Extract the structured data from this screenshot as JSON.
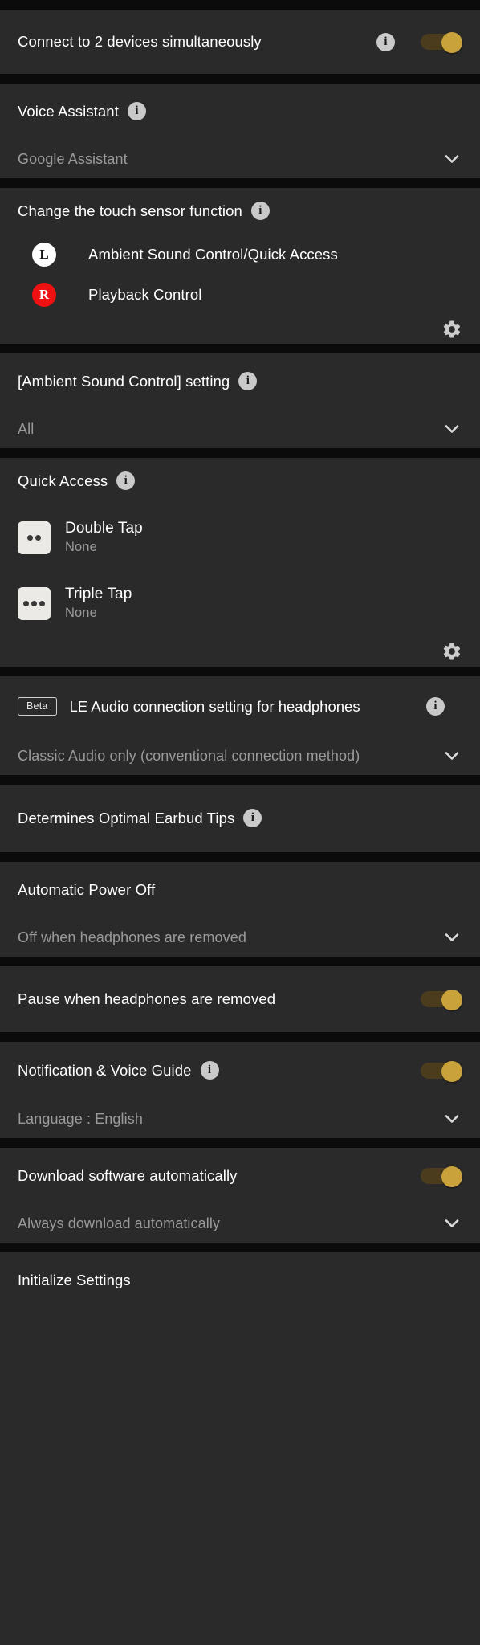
{
  "theme": {
    "page_bg": "#0b0b0b",
    "card_bg": "#2a2a2a",
    "title_color": "#ffffff",
    "secondary_color": "#9a9a9a",
    "toggle_on_knob": "#c9a23c",
    "toggle_on_track": "#4a3c1c",
    "badge_left_bg": "#ffffff",
    "badge_right_bg": "#ee1111"
  },
  "icons": {
    "info": "i",
    "chevron_down": "chevron-down-icon",
    "gear": "gear-icon"
  },
  "sections": {
    "multipoint": {
      "title": "Connect to 2 devices simultaneously",
      "toggle_state": "on"
    },
    "voice_assistant": {
      "title": "Voice Assistant",
      "value": "Google Assistant"
    },
    "touch_sensor": {
      "title": "Change the touch sensor function",
      "assignments": [
        {
          "side": "L",
          "label": "Ambient Sound Control/Quick Access"
        },
        {
          "side": "R",
          "label": "Playback Control"
        }
      ]
    },
    "ambient_sound_control": {
      "title": "[Ambient Sound Control] setting",
      "value": "All"
    },
    "quick_access": {
      "title": "Quick Access",
      "gestures": [
        {
          "icon": "double-tap-icon",
          "dots": 2,
          "name": "Double Tap",
          "value": "None"
        },
        {
          "icon": "triple-tap-icon",
          "dots": 3,
          "name": "Triple Tap",
          "value": "None"
        }
      ]
    },
    "le_audio": {
      "badge": "Beta",
      "title": "LE Audio connection setting for headphones",
      "value": "Classic Audio only (conventional connection method)"
    },
    "earbud_tips": {
      "title": "Determines Optimal Earbud Tips"
    },
    "auto_power_off": {
      "title": "Automatic Power Off",
      "value": "Off when headphones are removed"
    },
    "pause_on_removal": {
      "title": "Pause when headphones are removed",
      "toggle_state": "on"
    },
    "notification_voice_guide": {
      "title": "Notification & Voice Guide",
      "toggle_state": "on",
      "value": "Language : English"
    },
    "auto_download": {
      "title": "Download software automatically",
      "toggle_state": "on",
      "value": "Always download automatically"
    },
    "initialize": {
      "title": "Initialize Settings"
    }
  }
}
